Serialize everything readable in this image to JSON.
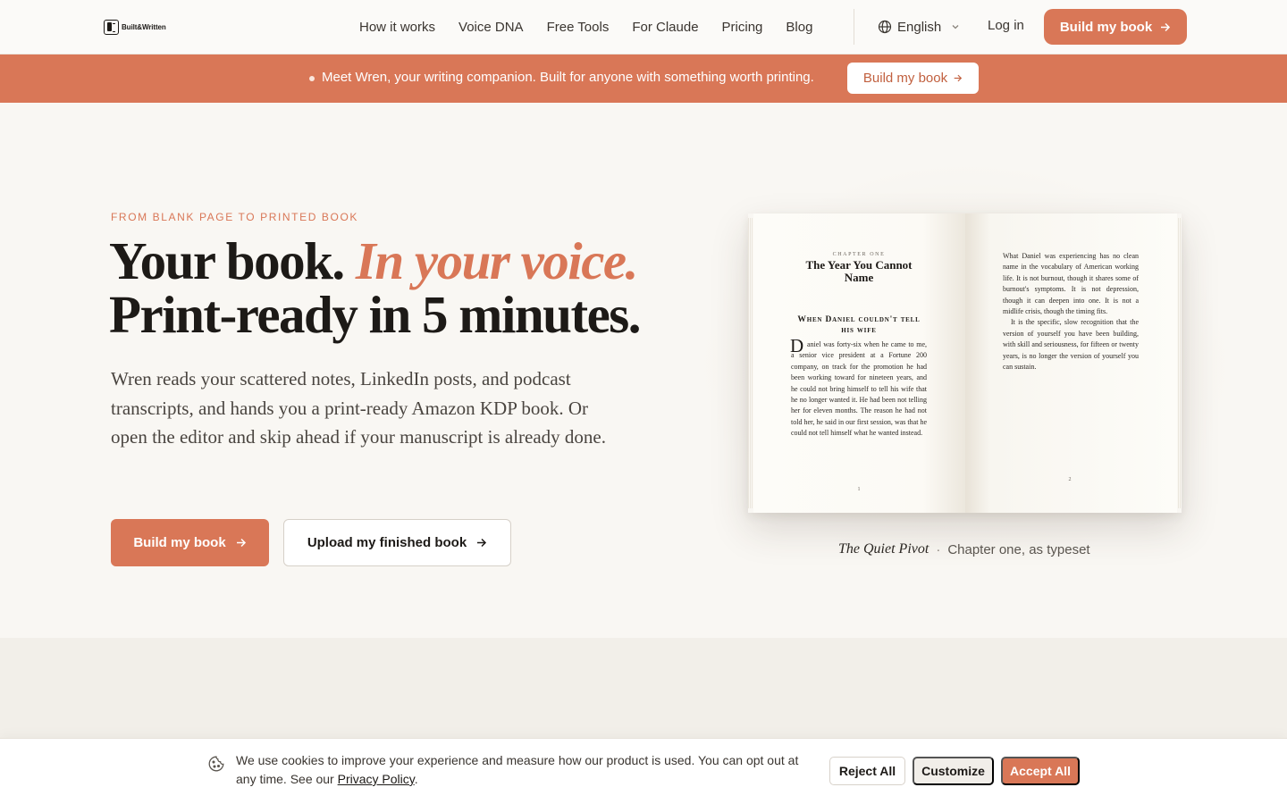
{
  "brand": {
    "name": "Built&Written",
    "accent": "#d97757"
  },
  "nav": {
    "links": [
      "How it works",
      "Voice DNA",
      "Free Tools",
      "For Claude",
      "Pricing",
      "Blog"
    ],
    "language": "English",
    "login": "Log in",
    "cta": "Build my book"
  },
  "announcement": {
    "text": "Meet Wren, your writing companion. Built for anyone with something worth printing.",
    "button": "Build my book"
  },
  "hero": {
    "eyebrow": "From blank page to printed book",
    "headline_1": "Your book.",
    "headline_accent": "In your voice.",
    "headline_2": "Print-ready in 5 minutes.",
    "subcopy": "Wren reads your scattered notes, LinkedIn posts, and podcast transcripts, and hands you a print-ready Amazon KDP book. Or open the editor and skip ahead if your manuscript is already done.",
    "primary_button": "Build my book",
    "secondary_button": "Upload my finished book"
  },
  "book": {
    "chapter_label": "Chapter One",
    "chapter_title": "The Year You Cannot Name",
    "section_heading": "When Daniel couldn't tell his wife",
    "dropcap": "D",
    "left_text": "aniel was forty-six when he came to me, a senior vice president at a Fortune 200 company, on track for the promotion he had been working toward for nineteen years, and he could not bring himself to tell his wife that he no longer wanted it. He had been not telling her for eleven months. The reason he had not told her, he said in our first session, was that he could not tell himself what he wanted instead.",
    "right_p1": "What Daniel was experiencing has no clean name in the vocabulary of American working life. It is not burnout, though it shares some of burnout's symptoms. It is not depression, though it can deepen into one. It is not a midlife crisis, though the timing fits.",
    "right_p2": "It is the specific, slow recognition that the version of yourself you have been building, with skill and seriousness, for fifteen or twenty years, is no longer the version of yourself you can sustain.",
    "folio_left": "1",
    "folio_right": "2",
    "caption_title": "The Quiet Pivot",
    "caption_sep": "·",
    "caption_text": "Chapter one, as typeset"
  },
  "cookie": {
    "text": "We use cookies to improve your experience and measure how our product is used. You can opt out at any time. See our",
    "link": "Privacy Policy",
    "period": ".",
    "reject": "Reject All",
    "customize": "Customize",
    "accept": "Accept All"
  }
}
